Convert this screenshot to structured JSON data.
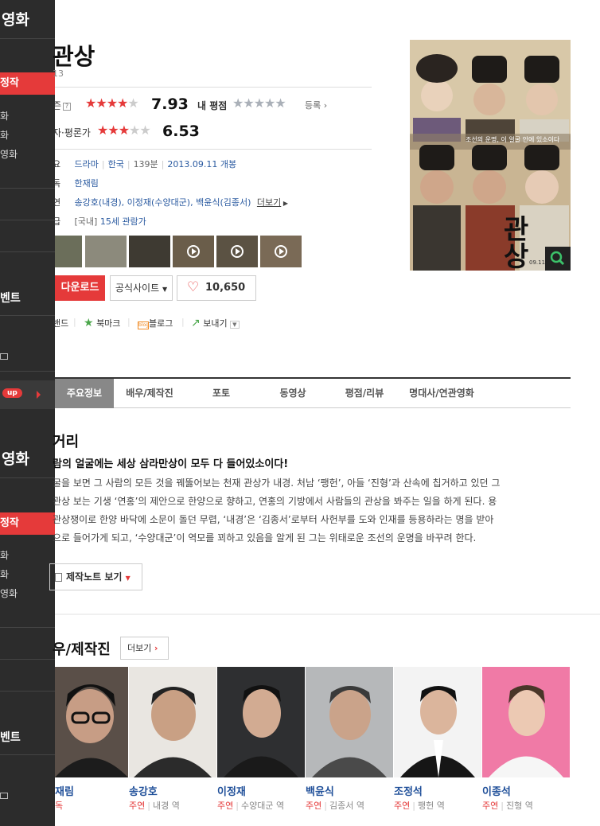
{
  "sidebar": {
    "section1_title": "영화",
    "section1_active": "정작",
    "section1_sub": [
      "화",
      "화",
      "영화"
    ],
    "section1_event": "벤트",
    "up_badge": "up",
    "section2_title": "영화",
    "section2_active": "정작",
    "section2_sub": [
      "화",
      "화",
      "영화"
    ],
    "section2_event": "벤트"
  },
  "movie": {
    "title": "관상",
    "year": "13",
    "netizen_label": "즌",
    "netizen_score": "7.93",
    "netizen_stars": 4,
    "my_rating_label": "내 평점",
    "register_label": "등록",
    "critic_label": "자·평론가",
    "critic_score": "6.53",
    "critic_stars": 3,
    "info": {
      "genre_key": "요",
      "genre": "드라마",
      "country": "한국",
      "runtime": "139분",
      "release": "2013.09.11 개봉",
      "director_key": "독",
      "director": "한재림",
      "cast_key": "연",
      "cast_list": "송강호(내경), 이정재(수양대군), 백윤식(김종서)",
      "cast_more": "더보기",
      "rating_key": "급",
      "rating_prefix": "[국내]",
      "rating": "15세 관람가"
    },
    "actions": {
      "download": "다운로드",
      "official_site": "공식사이트",
      "likes": "10,650",
      "band": "밴드",
      "bookmark": "북마크",
      "blog": "블로그",
      "blog_icon_text": "blog",
      "send": "보내기"
    },
    "poster_tagline": "조선의 운명, 이 얼굴 안에 있소이다",
    "poster_title": "관상",
    "poster_date": "09.11"
  },
  "tabs": [
    "주요정보",
    "배우/제작진",
    "포토",
    "동영상",
    "평점/리뷰",
    "명대사/연관영화"
  ],
  "synopsis": {
    "heading": "거리",
    "lead": "람의 얼굴에는 세상 삼라만상이 모두 다 들어있소이다!",
    "lines": [
      "굴을 보면 그 사람의 모든 것을 꿰뚫어보는 천재 관상가 내경. 처남 ‘팽헌’, 아들 ‘진형’과 산속에 칩거하고 있던 그",
      "관상 보는 기생 ‘연홍’의 제안으로 한양으로 향하고, 연홍의 기방에서 사람들의 관상을 봐주는 일을 하게 된다. 용",
      "관상쟁이로 한양 바닥에 소문이 돌던 무렵, ‘내경’은 ‘김종서’로부터 사헌부를 도와 인재를 등용하라는 명을 받아",
      "으로 들어가게 되고, ‘수양대군’이 역모를 꾀하고 있음을 알게 된 그는 위태로운 조선의 운명을 바꾸려 한다."
    ],
    "note_button": "제작노트 보기"
  },
  "cast_section": {
    "heading": "우/제작진",
    "more": "더보기",
    "people": [
      {
        "name": "재림",
        "role_main": "독",
        "role": ""
      },
      {
        "name": "송강호",
        "role_main": "주연",
        "role": "내경 역"
      },
      {
        "name": "이정재",
        "role_main": "주연",
        "role": "수양대군 역"
      },
      {
        "name": "백윤식",
        "role_main": "주연",
        "role": "김종서 역"
      },
      {
        "name": "조정석",
        "role_main": "주연",
        "role": "팽헌 역"
      },
      {
        "name": "이종석",
        "role_main": "주연",
        "role": "진형 역"
      }
    ]
  },
  "colors": {
    "accent": "#e53a3a",
    "link": "#2a5aa0",
    "sidebar": "#2c2c2c"
  }
}
